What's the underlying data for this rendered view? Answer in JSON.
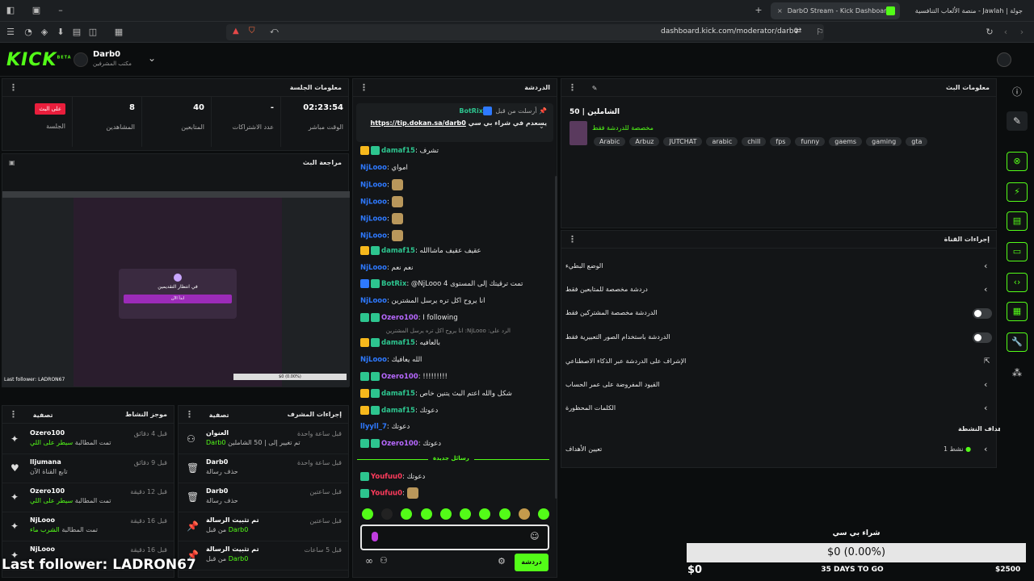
{
  "browser": {
    "tabs": [
      {
        "label": "DarbO Stream - Kick Dashboard"
      },
      {
        "label": "جولة | Jawlah - منصة الألعاب التنافسية"
      }
    ],
    "url": "dashboard.kick.com/moderator/darb0"
  },
  "header": {
    "logo": "KICK",
    "logo_sup": "BETA",
    "channel_name": "Darb0",
    "channel_role": "مكتب المشرفين"
  },
  "session": {
    "title": "معلومات الجلسة",
    "live_badge": "على البث",
    "stats": [
      {
        "value": "02:23:54",
        "label": "الوقت مباشر"
      },
      {
        "value": "-",
        "label": "عدد الاشتراكات"
      },
      {
        "value": "40",
        "label": "المتابعين"
      },
      {
        "value": "8",
        "label": "المشاهدين"
      },
      {
        "value": "",
        "label": "الجلسة"
      }
    ]
  },
  "preview": {
    "title": "مراجعة البث",
    "popup_title": "في انتظار التقديمين",
    "popup_button": "ابدأ الآن",
    "last_follower_small": "Last follower: LADRON67",
    "amount_small": "$0 (0.00%)"
  },
  "activity_feed": {
    "title": "موجز النشاط",
    "filter": "تصفية",
    "items": [
      {
        "name": "Ozero100",
        "sub": "تمت المطالبة",
        "sub2": "سيطر على اللي",
        "time": "قبل 4 دقائق"
      },
      {
        "name": "lljumana",
        "sub": "تابع القناة الآن",
        "sub2": "",
        "time": "قبل 9 دقائق"
      },
      {
        "name": "Ozero100",
        "sub": "تمت المطالبة",
        "sub2": "سيطر على اللي",
        "time": "قبل 12 دقيقة"
      },
      {
        "name": "NjLooo",
        "sub": "تمت المطالبة",
        "sub2": "الشرب ماء",
        "time": "قبل 16 دقيقة"
      },
      {
        "name": "NjLooo",
        "sub": "",
        "sub2": "",
        "time": "قبل 16 دقيقة"
      }
    ]
  },
  "mod_actions": {
    "title": "إجراءات المشرف",
    "filter": "تصفية",
    "items": [
      {
        "name": "العنوان",
        "sub": "تم تغيير إلى | 50 الشاملين",
        "by": "Darb0",
        "time": "قبل ساعة واحدة"
      },
      {
        "name": "Darb0",
        "sub": "حذف رسالة",
        "by": "",
        "time": "قبل ساعة واحدة"
      },
      {
        "name": "Darb0",
        "sub": "حذف رسالة",
        "by": "",
        "time": "قبل ساعتين"
      },
      {
        "name": "تم تثبيت الرسالة",
        "sub": "من قبل",
        "by": "Darb0",
        "time": "قبل ساعتين"
      },
      {
        "name": "تم تثبيت الرسالة",
        "sub": "من قبل",
        "by": "Darb0",
        "time": "قبل 5 ساعات"
      }
    ]
  },
  "chat": {
    "title": "الدردشة",
    "pinned_by": "أرسلت من قبل",
    "pinned_user": "BotRix",
    "pinned_text": "يسعدم في شراء بي سي",
    "pinned_link": "https://tip.dokan.sa/darb0",
    "messages": [
      {
        "user": "damaf15",
        "color": "#2dc58f",
        "badges": [
          "crown",
          "green"
        ],
        "text": "تشرف",
        "emoji": false
      },
      {
        "user": "NjLooo",
        "color": "#2e79ff",
        "badges": [],
        "text": "امواي",
        "emoji": false
      },
      {
        "user": "NjLooo",
        "color": "#2e79ff",
        "badges": [],
        "text": "",
        "emoji": true
      },
      {
        "user": "NjLooo",
        "color": "#2e79ff",
        "badges": [],
        "text": "",
        "emoji": true
      },
      {
        "user": "NjLooo",
        "color": "#2e79ff",
        "badges": [],
        "text": "",
        "emoji": true
      },
      {
        "user": "NjLooo",
        "color": "#2e79ff",
        "badges": [],
        "text": "",
        "emoji": true
      },
      {
        "user": "damaf15",
        "color": "#2dc58f",
        "badges": [
          "crown",
          "green"
        ],
        "text": "عقيف عقيف ماشاالله",
        "emoji": false
      },
      {
        "user": "NjLooo",
        "color": "#2e79ff",
        "badges": [],
        "text": "نعم نعم",
        "emoji": false
      },
      {
        "user": "BotRix",
        "color": "#2dc58f",
        "badges": [
          "blue",
          "green"
        ],
        "text": "@NjLooo تمت ترقيتك إلى المستوى 4",
        "emoji": false
      },
      {
        "user": "NjLooo",
        "color": "#2e79ff",
        "badges": [],
        "text": "انا يروح اكل تره يرسل المشترين",
        "emoji": false
      },
      {
        "user": "Ozero100",
        "color": "#b768ff",
        "badges": [
          "green",
          "green"
        ],
        "text": "I following",
        "emoji": false
      },
      {
        "user": "damaf15",
        "color": "#2dc58f",
        "badges": [
          "crown",
          "green"
        ],
        "text": "بالعافيه",
        "emoji": false
      },
      {
        "user": "NjLooo",
        "color": "#2e79ff",
        "badges": [],
        "text": "الله يعافيك",
        "emoji": false
      },
      {
        "user": "Ozero100",
        "color": "#b768ff",
        "badges": [
          "green",
          "green"
        ],
        "text": "!!!!!!!!!",
        "emoji": false
      },
      {
        "user": "damaf15",
        "color": "#2dc58f",
        "badges": [
          "crown",
          "green"
        ],
        "text": "شكل والله اعتم البث يتنين خاص",
        "emoji": false
      },
      {
        "user": "damaf15",
        "color": "#2dc58f",
        "badges": [
          "crown",
          "green"
        ],
        "text": "دعوتك",
        "emoji": false
      },
      {
        "user": "llyyll_7",
        "color": "#2e79ff",
        "badges": [],
        "text": "دعوتك",
        "emoji": false
      },
      {
        "user": "Ozero100",
        "color": "#b768ff",
        "badges": [
          "green",
          "green"
        ],
        "text": "دعوتك",
        "emoji": false
      }
    ],
    "reply_hint": "الرد على: NjLooo: انا يروح اكل تره يرسل المشترين",
    "new_messages": "رسائل جديدة",
    "new_msgs": [
      {
        "user": "Youfuu0",
        "color": "#ff3b5c",
        "text": "دعوتك"
      },
      {
        "user": "Youfuu0",
        "color": "#ff3b5c",
        "text": ""
      }
    ],
    "input_value": "",
    "send_label": "دردشة"
  },
  "stream_info": {
    "title": "معلومات البث",
    "stream_title": "50 | الشاملين",
    "category": "مخصصة للدردشة فقط",
    "tags": [
      "Arabic",
      "Arbuz",
      "JUTCHAT",
      "arabic",
      "chill",
      "fps",
      "funny",
      "gaems",
      "gaming",
      "gta"
    ]
  },
  "chat_settings": {
    "title": "إجراءات القناة",
    "rows": [
      {
        "label": "الوضع البطيء",
        "control": "chevron"
      },
      {
        "label": "دردشة مخصصة للمتابعين فقط",
        "control": "chevron"
      },
      {
        "label": "الدردشة مخصصة المشتركين فقط",
        "control": "toggle"
      },
      {
        "label": "الدردشة باستخدام الصور التعبيرية فقط",
        "control": "toggle"
      },
      {
        "label": "الإشراف على الدردشة عبر الذكاء الاصطناعي",
        "control": "external"
      },
      {
        "label": "القيود المفروضة على عمر الحساب",
        "control": "chevron"
      },
      {
        "label": "الكلمات المحظورة",
        "control": "chevron"
      }
    ],
    "active_goal_label": "أهداف النشطة",
    "goal_row_label": "تعيين الأهداف",
    "goal_count": "نشط 1"
  },
  "goal_overlay": {
    "title": "شراء بي سي",
    "amount": "$0 (0.00%)",
    "start": "$0",
    "days": "35 DAYS TO GO",
    "end": "$2500",
    "progress": 0
  },
  "overlay_text": {
    "last_follower": "Last follower: LADRON67"
  },
  "colors": {
    "accent": "#53fc18",
    "live": "#e91e3c"
  }
}
